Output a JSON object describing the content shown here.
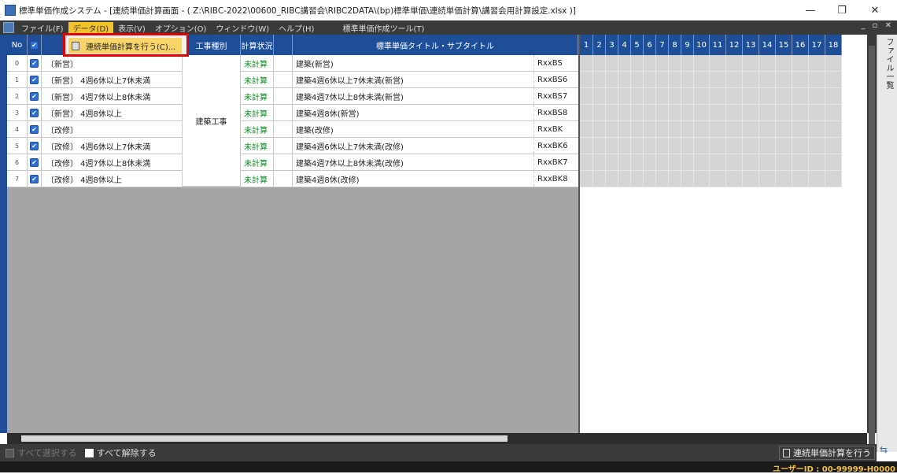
{
  "window": {
    "title": "標準単価作成システム - [連続単価計算画面 - ( Z:\\RIBC-2022\\00600_RIBC講習会\\RIBC2DATA\\(bp)標準単価\\連続単価計算\\講習会用計算設定.xlsx )]",
    "minimize": "—",
    "restore": "❐",
    "close": "✕"
  },
  "menu": {
    "items": [
      "ファイル(F)",
      "データ(D)",
      "表示(V)",
      "オプション(O)",
      "ウィンドウ(W)",
      "ヘルプ(H)"
    ],
    "tool_label": "標準単価作成ツール(T)",
    "mdi_controls": "_ ▫ ✕"
  },
  "dropdown": {
    "item_label": "連続単価計算を行う(C)..."
  },
  "grid": {
    "headers": {
      "no": "No",
      "check": "✔",
      "case": "",
      "kind": "工事種別",
      "status": "計算状況",
      "title": "標準単価タイトル・サブタイトル",
      "code": ""
    },
    "merged_kind": "建築工事",
    "rows": [
      {
        "no": "0",
        "case": "〔新営〕",
        "status": "未計算",
        "title": "建築(新営)",
        "code": "RxxBS"
      },
      {
        "no": "1",
        "case": "〔新営〕 4週6休以上7休未満",
        "status": "未計算",
        "title": "建築4週6休以上7休未満(新営)",
        "code": "RxxBS6"
      },
      {
        "no": "2",
        "case": "〔新営〕 4週7休以上8休未満",
        "status": "未計算",
        "title": "建築4週7休以上8休未満(新営)",
        "code": "RxxBS7"
      },
      {
        "no": "3",
        "case": "〔新営〕 4週8休以上",
        "status": "未計算",
        "title": "建築4週8休(新営)",
        "code": "RxxBS8"
      },
      {
        "no": "4",
        "case": "〔改修〕",
        "status": "未計算",
        "title": "建築(改修)",
        "code": "RxxBK"
      },
      {
        "no": "5",
        "case": "〔改修〕 4週6休以上7休未満",
        "status": "未計算",
        "title": "建築4週6休以上7休未満(改修)",
        "code": "RxxBK6"
      },
      {
        "no": "6",
        "case": "〔改修〕 4週7休以上8休未満",
        "status": "未計算",
        "title": "建築4週7休以上8休未満(改修)",
        "code": "RxxBK7"
      },
      {
        "no": "7",
        "case": "〔改修〕 4週8休以上",
        "status": "未計算",
        "title": "建築4週8休(改修)",
        "code": "RxxBK8"
      }
    ],
    "right_columns": [
      "1",
      "2",
      "3",
      "4",
      "5",
      "6",
      "7",
      "8",
      "9",
      "10",
      "11",
      "12",
      "13",
      "14",
      "15",
      "16",
      "17",
      "18"
    ]
  },
  "side_panel": {
    "tab_label": "ファイル一覧"
  },
  "bottom": {
    "select_all": "すべて選択する",
    "deselect_all": "すべて解除する",
    "calc_button": "連続単価計算を行う"
  },
  "status": {
    "user_id": "ユーザーID : 00-99999-H0000"
  },
  "colors": {
    "header_blue": "#1f4e99",
    "status_green": "#0a8f1f",
    "highlight_red": "#e00000",
    "menu_active": "#f6c22a"
  }
}
